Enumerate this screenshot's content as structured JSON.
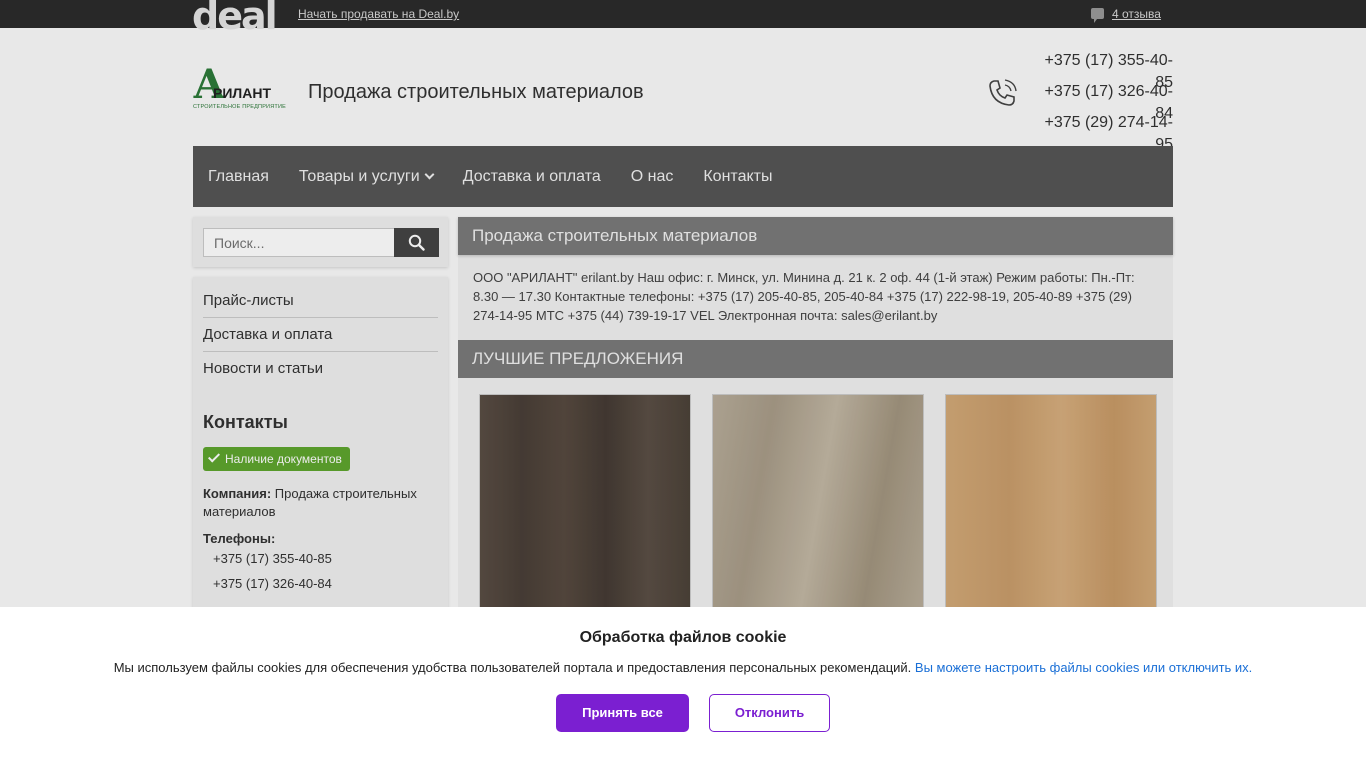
{
  "topbar": {
    "logo_text": "deal",
    "sell_link": "Начать продавать на Deal.by",
    "reviews": "4 отзыва"
  },
  "header": {
    "logo": {
      "letter": "А",
      "name": "РИЛАНТ",
      "subtitle": "СТРОИТЕЛЬНОЕ ПРЕДПРИЯТИЕ"
    },
    "site_title": "Продажа строительных материалов",
    "phones": [
      "+375 (17) 355-40-85",
      "+375 (17) 326-40-84",
      "+375 (29) 274-14-95"
    ]
  },
  "nav": {
    "items": [
      "Главная",
      "Товары и услуги",
      "Доставка и оплата",
      "О нас",
      "Контакты"
    ]
  },
  "search": {
    "placeholder": "Поиск..."
  },
  "sidebar": {
    "links": [
      "Прайс-листы",
      "Доставка и оплата",
      "Новости и статьи"
    ],
    "contacts_heading": "Контакты",
    "docs_badge": "Наличие документов",
    "company_label": "Компания:",
    "company_value": "Продажа строительных материалов",
    "phones_label": "Телефоны:",
    "phones": [
      "+375 (17) 355-40-85",
      "+375 (17) 326-40-84"
    ]
  },
  "main": {
    "heading": "Продажа строительных материалов",
    "about": "ООО \"АРИЛАНТ\" erilant.by Наш офис: г. Минск, ул. Минина д. 21 к. 2 оф. 44 (1-й этаж) Режим работы: Пн.-Пт: 8.30 — 17.30 Контактные телефоны: +375 (17) 205-40-85, 205-40-84 +375 (17) 222-98-19, 205-40-89 +375 (29) 274-14-95 МТС +375 (44) 739-19-17 VEL Электронная почта: sales@erilant.by",
    "best_heading": "ЛУЧШИЕ ПРЕДЛОЖЕНИЯ"
  },
  "cookie": {
    "title": "Обработка файлов cookie",
    "text": "Мы используем файлы cookies для обеспечения удобства пользователей портала и предоставления персональных рекомендаций.",
    "link": "Вы можете настроить файлы cookies или отключить их.",
    "accept": "Принять все",
    "decline": "Отклонить"
  },
  "colors": {
    "nav_bg": "#555555",
    "accent_purple": "#7b1fd1",
    "badge_green": "#5ea52e",
    "link_blue": "#1a6fd6"
  }
}
